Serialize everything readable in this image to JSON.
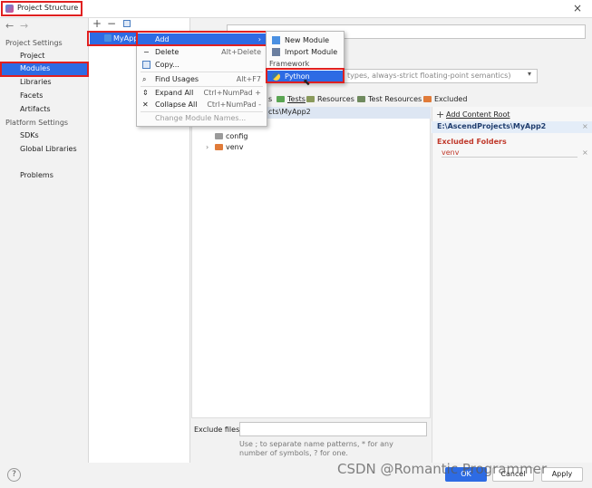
{
  "window": {
    "title": "Project Structure",
    "close_icon": "×"
  },
  "nav": {
    "back": "←",
    "forward": "→"
  },
  "sidebar": {
    "project_settings_header": "Project Settings",
    "items": [
      "Project",
      "Modules",
      "Libraries",
      "Facets",
      "Artifacts"
    ],
    "platform_settings_header": "Platform Settings",
    "platform_items": [
      "SDKs",
      "Global Libraries"
    ],
    "problems": "Problems"
  },
  "tree": {
    "add": "+",
    "remove": "−",
    "module_name": "MyApp2"
  },
  "context_menu": {
    "items": [
      {
        "label": "Add",
        "shortcut": "",
        "selected": true
      },
      {
        "label": "Delete",
        "shortcut": "Alt+Delete"
      },
      {
        "label": "Copy...",
        "shortcut": ""
      },
      {
        "label": "Find Usages",
        "shortcut": "Alt+F7"
      },
      {
        "label": "Expand All",
        "shortcut": "Ctrl+NumPad +"
      },
      {
        "label": "Collapse All",
        "shortcut": "Ctrl+NumPad -"
      },
      {
        "label": "Change Module Names...",
        "shortcut": ""
      }
    ]
  },
  "submenu": {
    "new_module": "New Module",
    "import_module": "Import Module",
    "framework_header": "Framework",
    "python": "Python"
  },
  "main": {
    "name_value": "MyApp2",
    "language_level": "types, always-strict floating-point semantics)",
    "mark_as": {
      "sources_tail": "s",
      "tests": "Tests",
      "resources": "Resources",
      "test_resources": "Test Resources",
      "excluded": "Excluded"
    },
    "content_path_tail": "cts\\MyApp2",
    "folders": [
      "config",
      "venv"
    ],
    "add_content_root": "Add Content Root",
    "root_path": "E:\\AscendProjects\\MyApp2",
    "excluded_folders_header": "Excluded Folders",
    "excluded_item": "venv",
    "exclude_files_label": "Exclude files:",
    "exclude_hint": "Use ; to separate name patterns, * for any number of symbols, ? for one."
  },
  "footer": {
    "help": "?",
    "ok": "OK",
    "cancel": "Cancel",
    "apply": "Apply",
    "watermark": "CSDN @Romantic Programmer"
  },
  "colors": {
    "selection": "#2d6be4",
    "highlight_box": "#e02020",
    "excluded": "#c0392b"
  }
}
